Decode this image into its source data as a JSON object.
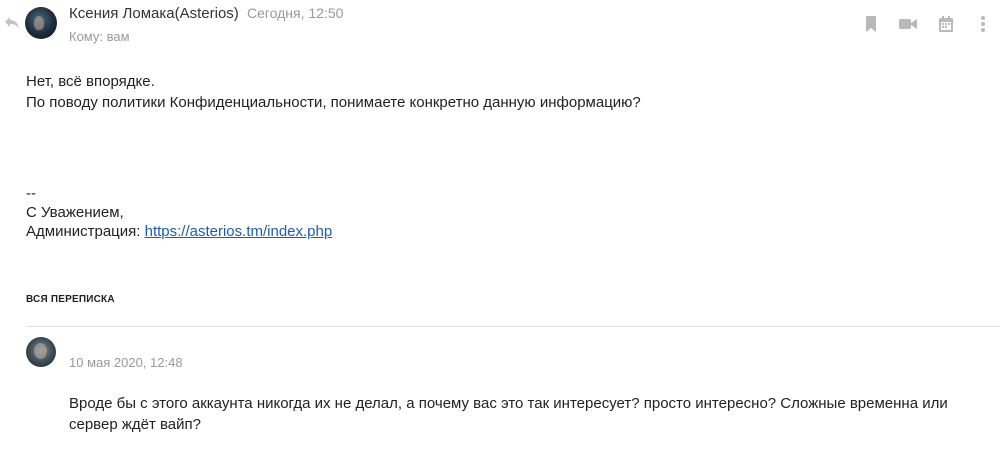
{
  "header": {
    "sender": "Ксения Ломака(Asterios)",
    "date": "Сегодня, 12:50",
    "recipient": "Кому: вам"
  },
  "icons": {
    "reply": "reply-icon",
    "bookmark": "bookmark-icon",
    "video": "video-icon",
    "calendar": "calendar-icon",
    "more": "more-icon"
  },
  "message": {
    "line1": "Нет, всё впорядке.",
    "line2": "По поводу политики Конфиденциальности, понимаете конкретно данную информацию?",
    "sig_dash": "--",
    "sig_greeting": "С Уважением,",
    "sig_admin": "Администрация:",
    "sig_link": "https://asterios.tm/index.php"
  },
  "thread": {
    "label": "ВСЯ ПЕРЕПИСКА",
    "item": {
      "date": "10 мая 2020, 12:48",
      "text": "Вроде бы с этого аккаунта никогда их не делал, а почему вас это так интересует? просто интересно? Сложные временна или сервер ждёт вайп?"
    }
  },
  "colors": {
    "icon": "#b9b9b9",
    "muted_text": "#999999",
    "link": "#1a5fb4"
  }
}
